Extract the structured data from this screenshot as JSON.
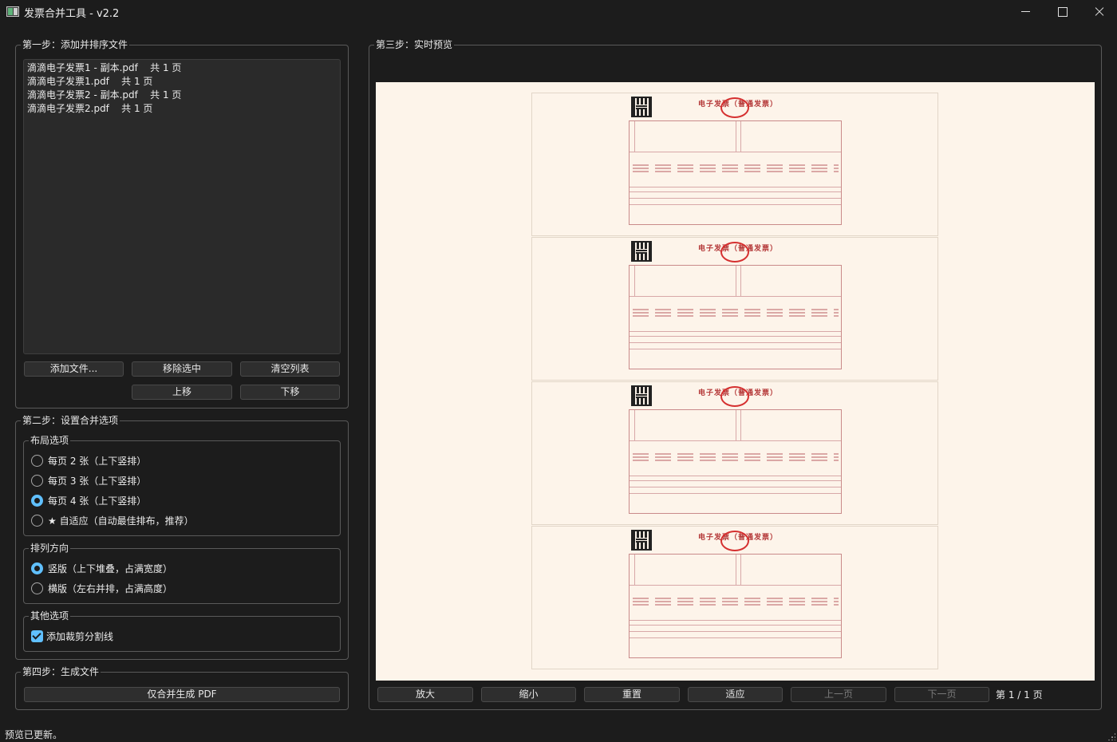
{
  "window": {
    "title": "发票合并工具 - v2.2"
  },
  "step1": {
    "title": "第一步：添加并排序文件",
    "files": [
      "滴滴电子发票1 - 副本.pdf    共 1 页",
      "滴滴电子发票1.pdf    共 1 页",
      "滴滴电子发票2 - 副本.pdf    共 1 页",
      "滴滴电子发票2.pdf    共 1 页"
    ],
    "add_label": "添加文件...",
    "remove_label": "移除选中",
    "clear_label": "清空列表",
    "up_label": "上移",
    "down_label": "下移"
  },
  "step2": {
    "title": "第二步：设置合并选项",
    "layout": {
      "title": "布局选项",
      "options": [
        {
          "label": "每页 2 张（上下竖排）",
          "checked": false
        },
        {
          "label": "每页 3 张（上下竖排）",
          "checked": false
        },
        {
          "label": "每页 4 张（上下竖排）",
          "checked": true
        },
        {
          "label": "★ 自适应（自动最佳排布，推荐）",
          "checked": false
        }
      ]
    },
    "direction": {
      "title": "排列方向",
      "options": [
        {
          "label": "竖版（上下堆叠，占满宽度）",
          "checked": true
        },
        {
          "label": "横版（左右并排，占满高度）",
          "checked": false
        }
      ]
    },
    "other": {
      "title": "其他选项",
      "crop_line_label": "添加裁剪分割线",
      "crop_line_checked": true
    }
  },
  "step4": {
    "title": "第四步：生成文件",
    "generate_label": "仅合并生成 PDF"
  },
  "step3": {
    "title": "第三步：实时预览",
    "invoice_title": "电子发票（普通发票）",
    "buttons": {
      "zoom_in": "放大",
      "zoom_out": "缩小",
      "reset": "重置",
      "fit": "适应",
      "prev": "上一页",
      "next": "下一页"
    },
    "page_indicator": "第 1 / 1 页",
    "pages_shown": 4
  },
  "status_bar": {
    "text": "预览已更新。"
  },
  "colors": {
    "background": "#1c1c1c",
    "accent": "#60c0ff",
    "preview_paper": "#fdf4ea",
    "invoice_red": "#b53a3a"
  }
}
